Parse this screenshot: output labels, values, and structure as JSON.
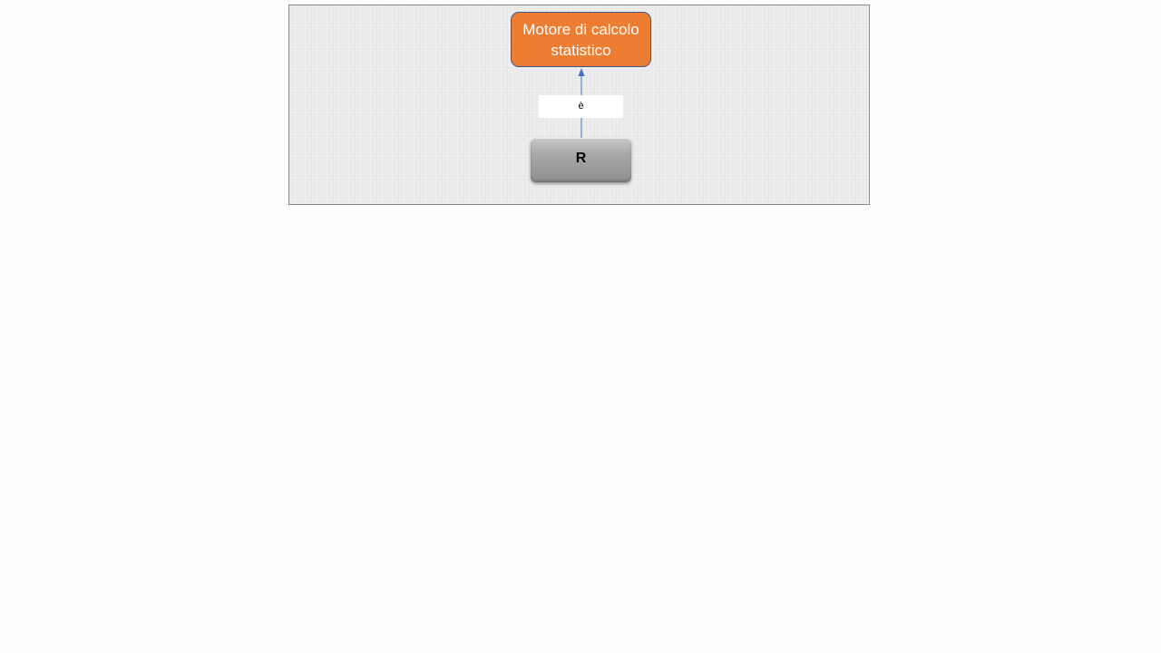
{
  "diagram": {
    "nodes": [
      {
        "id": "motore",
        "label": "Motore di calcolo statistico",
        "fill": "#ed7d31",
        "border": "#41588f",
        "text_color": "#ffffff"
      },
      {
        "id": "r",
        "label": "R",
        "fill": "#9b9b9b",
        "text_color": "#000000"
      }
    ],
    "edges": [
      {
        "from": "r",
        "to": "motore",
        "label": "è",
        "color": "#4472c4"
      }
    ]
  }
}
